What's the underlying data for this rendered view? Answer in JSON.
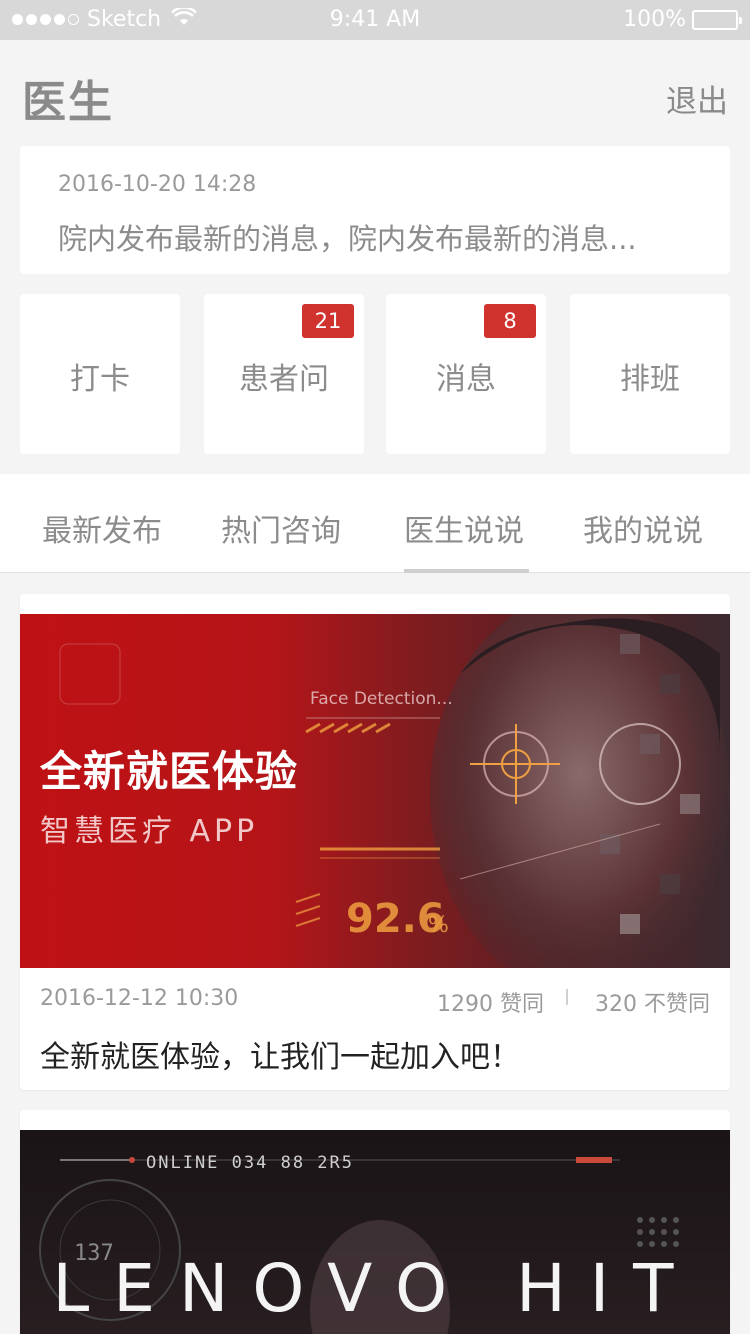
{
  "status_bar": {
    "carrier": "Sketch",
    "time": "9:41 AM",
    "battery": "100%"
  },
  "header": {
    "title": "医生",
    "logout_label": "退出"
  },
  "notice": {
    "time": "2016-10-20  14:28",
    "text": "院内发布最新的消息，院内发布最新的消息..."
  },
  "tiles": [
    {
      "label": "打卡",
      "badge": ""
    },
    {
      "label": "患者问",
      "badge": "21"
    },
    {
      "label": "消息",
      "badge": "8"
    },
    {
      "label": "排班",
      "badge": ""
    }
  ],
  "tabs": [
    "最新发布",
    "热门咨询",
    "医生说说",
    "我的说说"
  ],
  "active_tab": "医生说说",
  "feed": [
    {
      "banner_title": "全新就医体验",
      "banner_subtitle": "智慧医疗 APP",
      "banner_overlay_label": "Face Detection...",
      "banner_score": "92.6",
      "banner_score_unit": "%",
      "date": "2016-12-12 10:30",
      "likes": "1290 赞同",
      "dislikes": "320 不赞同",
      "text": "全新就医体验，让我们一起加入吧！"
    },
    {
      "banner_title": "LENOVO HIT",
      "hud_label": "ONLINE  034 88 2R5",
      "hud_number": "137"
    }
  ],
  "colors": {
    "accent_red": "#d0332d",
    "banner_red": "#bf1114",
    "background": "#f4f4f4"
  }
}
